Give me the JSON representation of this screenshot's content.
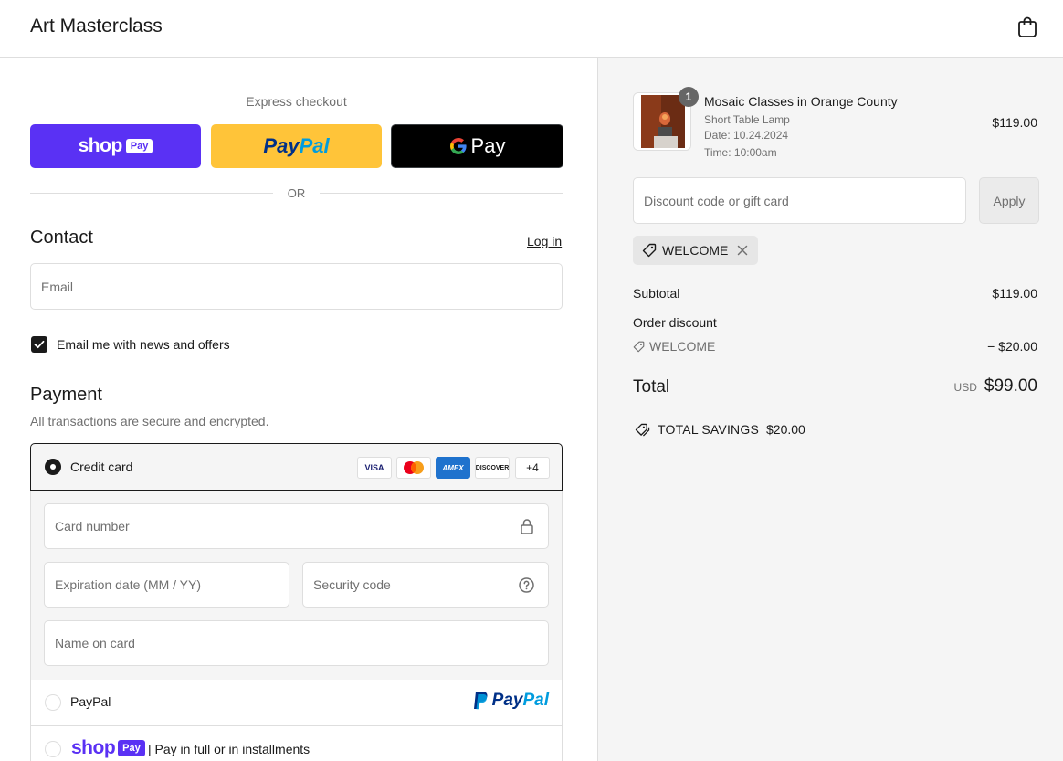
{
  "header": {
    "store_name": "Art Masterclass",
    "cart_icon": "shopping-bag-icon"
  },
  "express": {
    "title": "Express checkout",
    "shop_pay": {
      "word": "shop",
      "badge": "Pay"
    },
    "paypal": {
      "part1": "Pay",
      "part2": "Pal"
    },
    "gpay": {
      "g": "G",
      "word": "Pay"
    },
    "divider": "OR"
  },
  "contact": {
    "heading": "Contact",
    "login": "Log in",
    "email_placeholder": "Email",
    "newsletter_label": "Email me with news and offers"
  },
  "payment": {
    "heading": "Payment",
    "subtext": "All transactions are secure and encrypted.",
    "credit_card_label": "Credit card",
    "card_badges": {
      "visa": "VISA",
      "amex": "AMEX",
      "discover": "DISCOVER",
      "more": "+4"
    },
    "card_number_placeholder": "Card number",
    "expiration_placeholder": "Expiration date (MM / YY)",
    "security_placeholder": "Security code",
    "name_placeholder": "Name on card",
    "paypal_label": "PayPal",
    "paypal_logo": {
      "part1": "Pay",
      "part2": "Pal"
    },
    "shoppay_word": "shop",
    "shoppay_badge": "Pay",
    "shoppay_label": "| Pay in full or in installments"
  },
  "summary": {
    "item": {
      "quantity": "1",
      "name": "Mosaic Classes in Orange County",
      "variant": "Short Table Lamp",
      "date": "Date: 10.24.2024",
      "time": "Time: 10:00am",
      "price": "$119.00"
    },
    "discount_placeholder": "Discount code or gift card",
    "apply_label": "Apply",
    "applied_code": "WELCOME",
    "subtotal_label": "Subtotal",
    "subtotal_value": "$119.00",
    "order_discount_label": "Order discount",
    "discount_code": "WELCOME",
    "discount_value": "− $20.00",
    "total_label": "Total",
    "currency": "USD",
    "total_value": "$99.00",
    "savings_label": "TOTAL SAVINGS",
    "savings_value": "$20.00"
  },
  "colors": {
    "shop_purple": "#5a31f4",
    "paypal_yellow": "#ffc439",
    "paypal_navy": "#003087",
    "paypal_blue": "#009cde"
  }
}
